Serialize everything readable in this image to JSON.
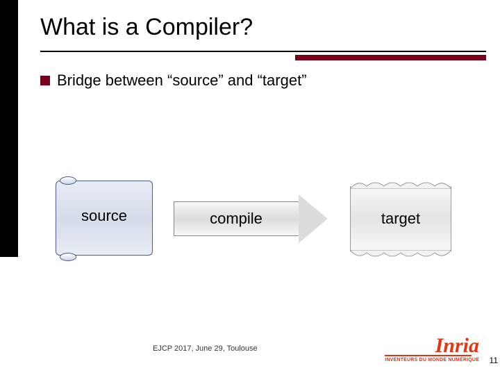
{
  "title": "What is a Compiler?",
  "bullet": "Bridge between “source” and “target”",
  "diagram": {
    "source": "source",
    "compile": "compile",
    "target": "target"
  },
  "footer": "EJCP 2017, June 29, Toulouse",
  "logo": {
    "name": "Inria",
    "tagline": "INVENTEURS DU MONDE NUMÉRIQUE"
  },
  "page": "11"
}
